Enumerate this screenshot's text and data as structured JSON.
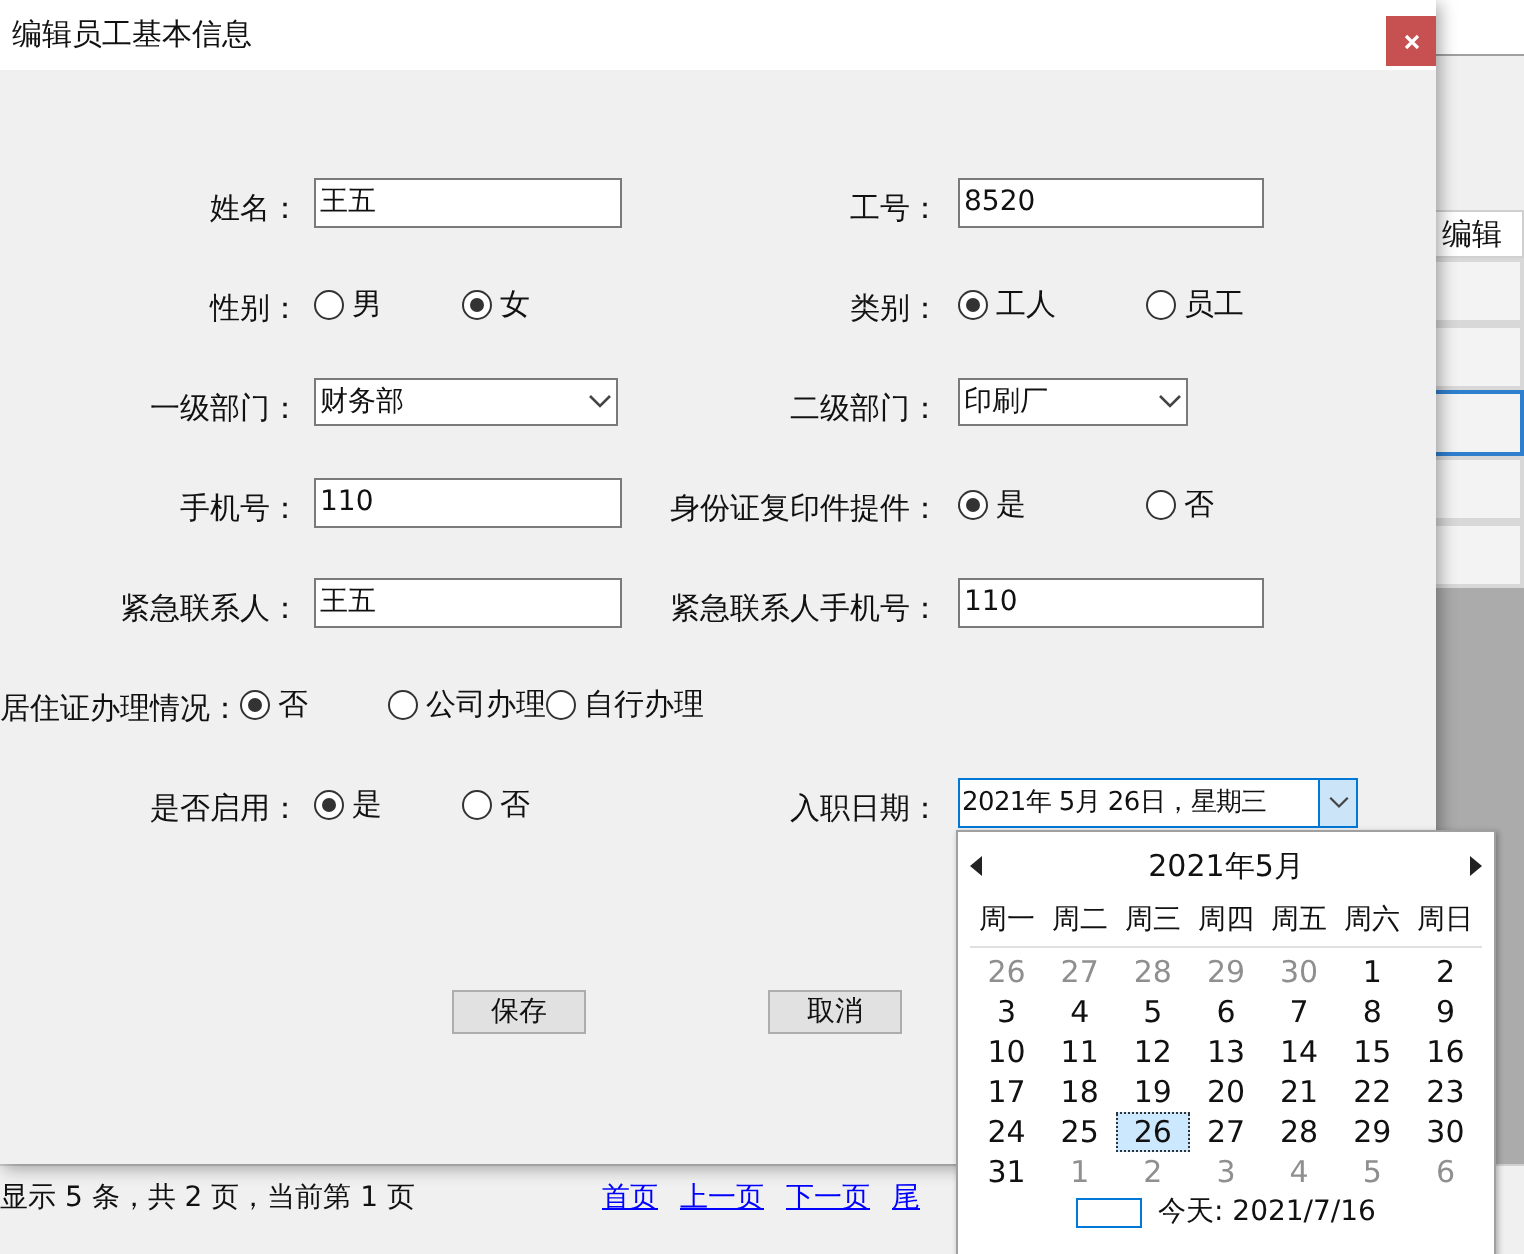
{
  "background_app": {
    "column_header": "编辑",
    "rows": [
      {
        "selected": false
      },
      {
        "selected": false
      },
      {
        "selected": true
      },
      {
        "selected": false
      },
      {
        "selected": false
      }
    ]
  },
  "status_bar": {
    "text": "显示 5 条，共 2 页，当前第 1 页",
    "links": [
      "首页",
      "上一页",
      "下一页",
      "尾"
    ]
  },
  "dialog": {
    "title": "编辑员工基本信息",
    "rows": [
      [
        {
          "kind": "text",
          "label": "姓名：",
          "value": "王五"
        },
        {
          "kind": "text",
          "label": "工号：",
          "value": "8520"
        }
      ],
      [
        {
          "kind": "radio",
          "label": "性别：",
          "options": [
            {
              "label": "男",
              "selected": false
            },
            {
              "label": "女",
              "selected": true
            }
          ]
        },
        {
          "kind": "radio",
          "label": "类别：",
          "options": [
            {
              "label": "工人",
              "selected": true
            },
            {
              "label": "员工",
              "selected": false
            }
          ]
        }
      ],
      [
        {
          "kind": "select",
          "label": "一级部门：",
          "value": "财务部"
        },
        {
          "kind": "select",
          "label": "二级部门：",
          "value": "印刷厂"
        }
      ],
      [
        {
          "kind": "text",
          "label": "手机号：",
          "value": "110"
        },
        {
          "kind": "radio",
          "label": "身份证复印件提件：",
          "options": [
            {
              "label": "是",
              "selected": true
            },
            {
              "label": "否",
              "selected": false
            }
          ]
        }
      ],
      [
        {
          "kind": "text",
          "label": "紧急联系人：",
          "value": "王五"
        },
        {
          "kind": "text",
          "label": "紧急联系人手机号：",
          "value": "110"
        }
      ],
      [
        {
          "kind": "radio",
          "label": "居住证办理情况：",
          "options": [
            {
              "label": "否",
              "selected": true
            },
            {
              "label": "公司办理",
              "selected": false
            },
            {
              "label": "自行办理",
              "selected": false
            }
          ]
        }
      ],
      [
        {
          "kind": "radio",
          "label": "是否启用：",
          "options": [
            {
              "label": "是",
              "selected": true
            },
            {
              "label": "否",
              "selected": false
            }
          ]
        },
        {
          "kind": "date",
          "label": "入职日期：",
          "value": "2021年 5月 26日，星期三",
          "expanded": true
        }
      ]
    ],
    "buttons": [
      "保存",
      "取消"
    ]
  },
  "calendar": {
    "title": "2021年5月",
    "weekdays": [
      "周一",
      "周二",
      "周三",
      "周四",
      "周五",
      "周六",
      "周日"
    ],
    "days": [
      {
        "label": "26",
        "outside": true,
        "selected": false
      },
      {
        "label": "27",
        "outside": true,
        "selected": false
      },
      {
        "label": "28",
        "outside": true,
        "selected": false
      },
      {
        "label": "29",
        "outside": true,
        "selected": false
      },
      {
        "label": "30",
        "outside": true,
        "selected": false
      },
      {
        "label": "1",
        "outside": false,
        "selected": false
      },
      {
        "label": "2",
        "outside": false,
        "selected": false
      },
      {
        "label": "3",
        "outside": false,
        "selected": false
      },
      {
        "label": "4",
        "outside": false,
        "selected": false
      },
      {
        "label": "5",
        "outside": false,
        "selected": false
      },
      {
        "label": "6",
        "outside": false,
        "selected": false
      },
      {
        "label": "7",
        "outside": false,
        "selected": false
      },
      {
        "label": "8",
        "outside": false,
        "selected": false
      },
      {
        "label": "9",
        "outside": false,
        "selected": false
      },
      {
        "label": "10",
        "outside": false,
        "selected": false
      },
      {
        "label": "11",
        "outside": false,
        "selected": false
      },
      {
        "label": "12",
        "outside": false,
        "selected": false
      },
      {
        "label": "13",
        "outside": false,
        "selected": false
      },
      {
        "label": "14",
        "outside": false,
        "selected": false
      },
      {
        "label": "15",
        "outside": false,
        "selected": false
      },
      {
        "label": "16",
        "outside": false,
        "selected": false
      },
      {
        "label": "17",
        "outside": false,
        "selected": false
      },
      {
        "label": "18",
        "outside": false,
        "selected": false
      },
      {
        "label": "19",
        "outside": false,
        "selected": false
      },
      {
        "label": "20",
        "outside": false,
        "selected": false
      },
      {
        "label": "21",
        "outside": false,
        "selected": false
      },
      {
        "label": "22",
        "outside": false,
        "selected": false
      },
      {
        "label": "23",
        "outside": false,
        "selected": false
      },
      {
        "label": "24",
        "outside": false,
        "selected": false
      },
      {
        "label": "25",
        "outside": false,
        "selected": false
      },
      {
        "label": "26",
        "outside": false,
        "selected": true
      },
      {
        "label": "27",
        "outside": false,
        "selected": false
      },
      {
        "label": "28",
        "outside": false,
        "selected": false
      },
      {
        "label": "29",
        "outside": false,
        "selected": false
      },
      {
        "label": "30",
        "outside": false,
        "selected": false
      },
      {
        "label": "31",
        "outside": false,
        "selected": false
      },
      {
        "label": "1",
        "outside": true,
        "selected": false
      },
      {
        "label": "2",
        "outside": true,
        "selected": false
      },
      {
        "label": "3",
        "outside": true,
        "selected": false
      },
      {
        "label": "4",
        "outside": true,
        "selected": false
      },
      {
        "label": "5",
        "outside": true,
        "selected": false
      },
      {
        "label": "6",
        "outside": true,
        "selected": false
      }
    ],
    "today": "今天: 2021/7/16"
  }
}
